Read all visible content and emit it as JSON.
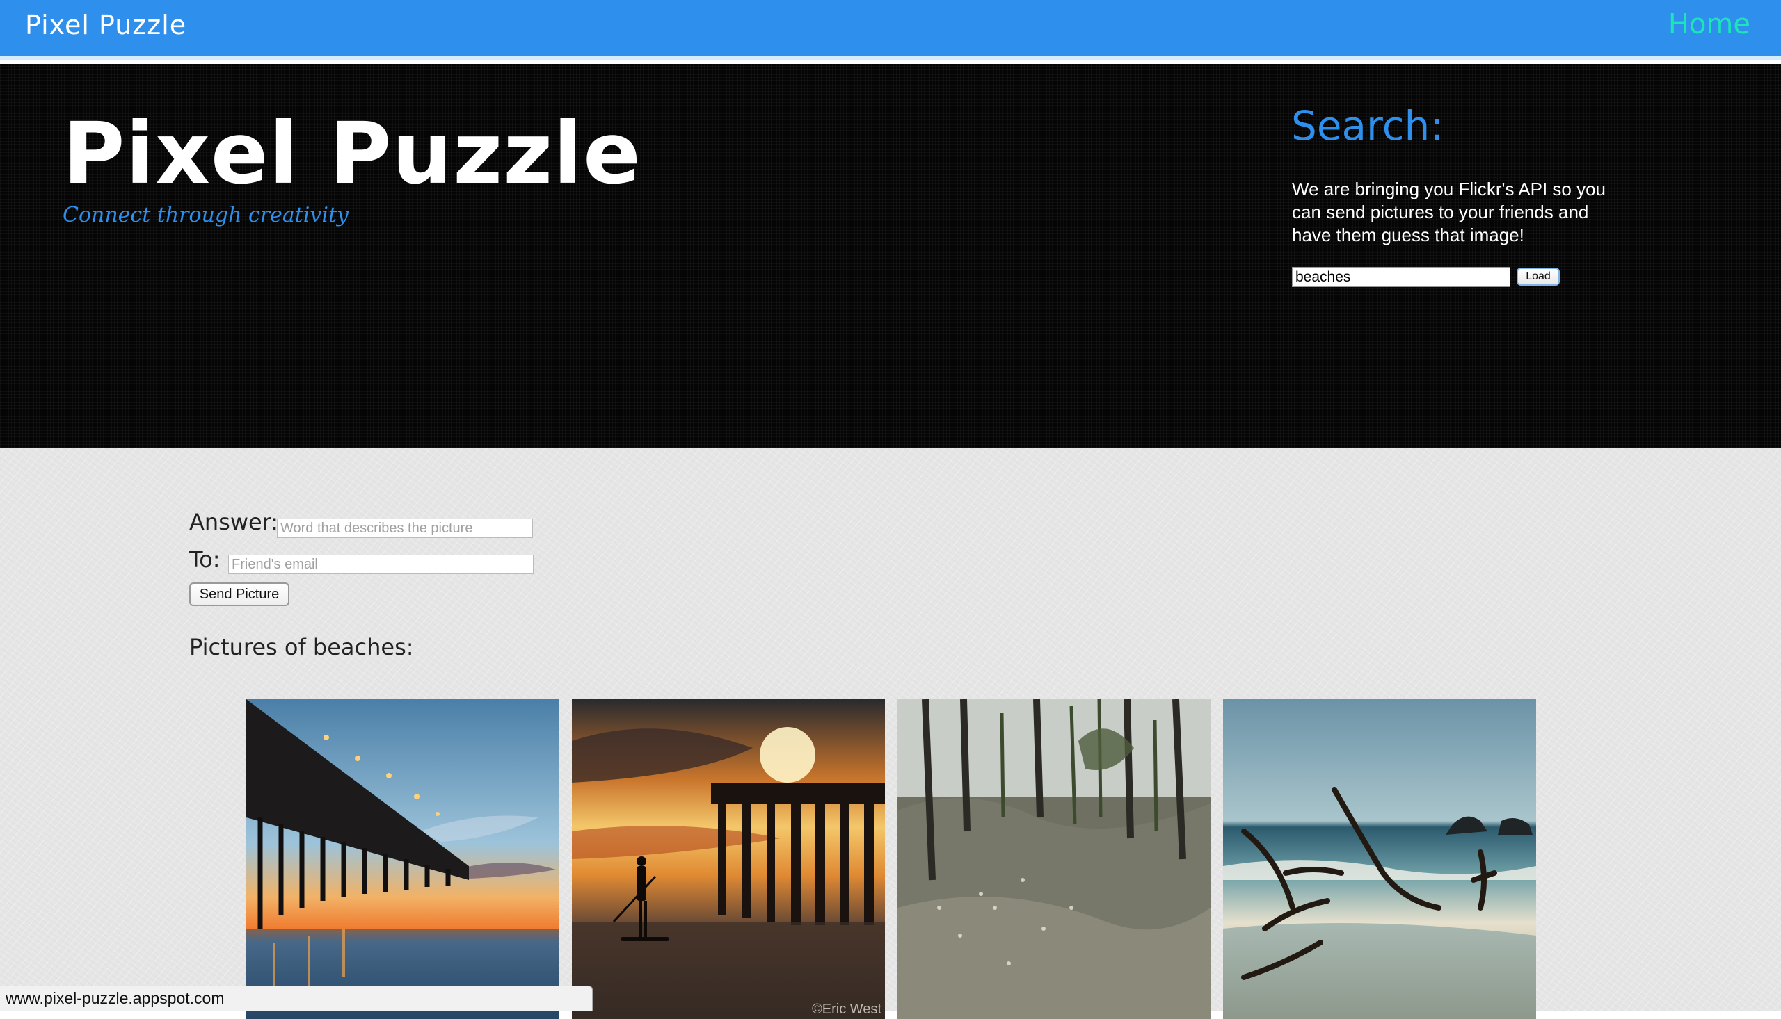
{
  "navbar": {
    "brand": "Pixel Puzzle",
    "home_link": "Home"
  },
  "hero": {
    "title": "Pixel Puzzle",
    "tagline": "Connect through creativity"
  },
  "search": {
    "heading": "Search:",
    "description": "We are bringing you Flickr's API so you can send pictures to your friends and have them guess that image!",
    "input_value": "beaches",
    "load_label": "Load"
  },
  "form": {
    "answer_label": "Answer:",
    "answer_placeholder": "Word that describes the picture",
    "to_label": "To:",
    "to_placeholder": "Friend's email",
    "send_label": "Send Picture"
  },
  "gallery": {
    "heading": "Pictures of beaches:",
    "photos": [
      {
        "subject": "pier-at-sunset"
      },
      {
        "subject": "paddleboarder-under-pier",
        "watermark": "©Eric West"
      },
      {
        "subject": "burnt-forest"
      },
      {
        "subject": "driftwood-on-beach"
      }
    ]
  },
  "status_bar": {
    "url": "www.pixel-puzzle.appspot.com"
  },
  "colors": {
    "navbar_blue": "#2f8fec",
    "home_link_teal": "#1ce6b9",
    "hero_black": "#050505",
    "content_gray": "#e6e6e6"
  }
}
